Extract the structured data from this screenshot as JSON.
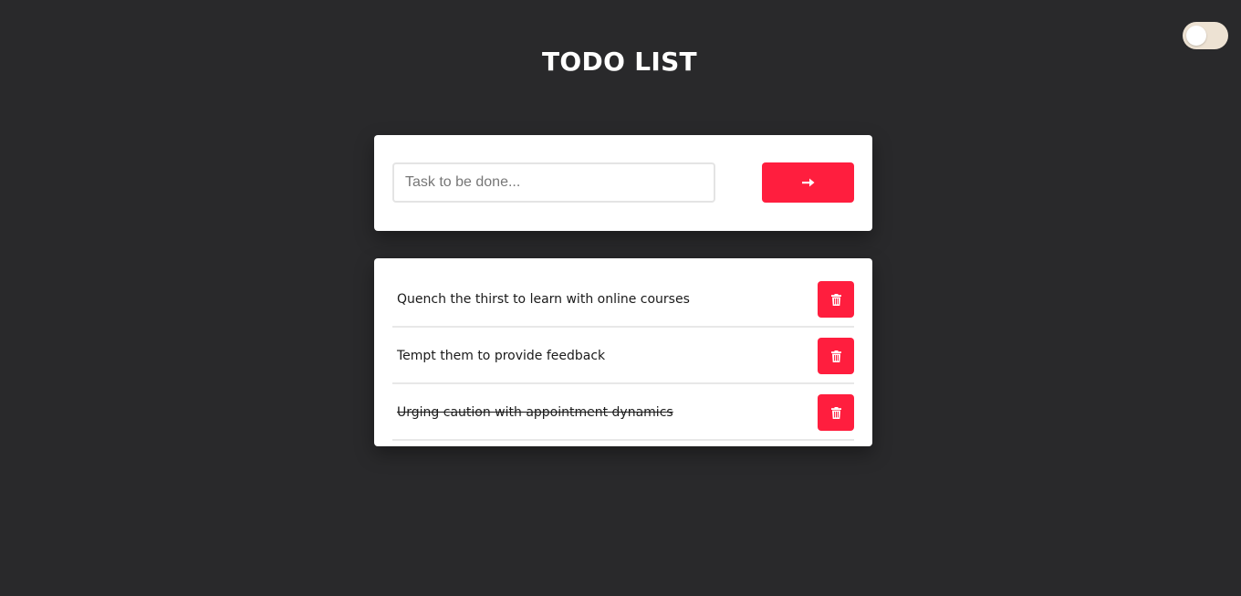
{
  "header": {
    "title": "TODO LIST"
  },
  "theme_toggle": {
    "state": "off"
  },
  "input": {
    "placeholder": "Task to be done...",
    "value": ""
  },
  "add_button": {
    "icon": "arrow-right-icon"
  },
  "todos": [
    {
      "text": "Quench the thirst to learn with online courses",
      "completed": false,
      "delete_icon": "trash-icon"
    },
    {
      "text": "Tempt them to provide feedback",
      "completed": false,
      "delete_icon": "trash-icon"
    },
    {
      "text": "Urging caution with appointment dynamics",
      "completed": true,
      "delete_icon": "trash-icon"
    }
  ],
  "colors": {
    "background": "#29292b",
    "accent": "#ff1e3e",
    "card": "#ffffff",
    "toggle_track": "#ede2d3"
  }
}
